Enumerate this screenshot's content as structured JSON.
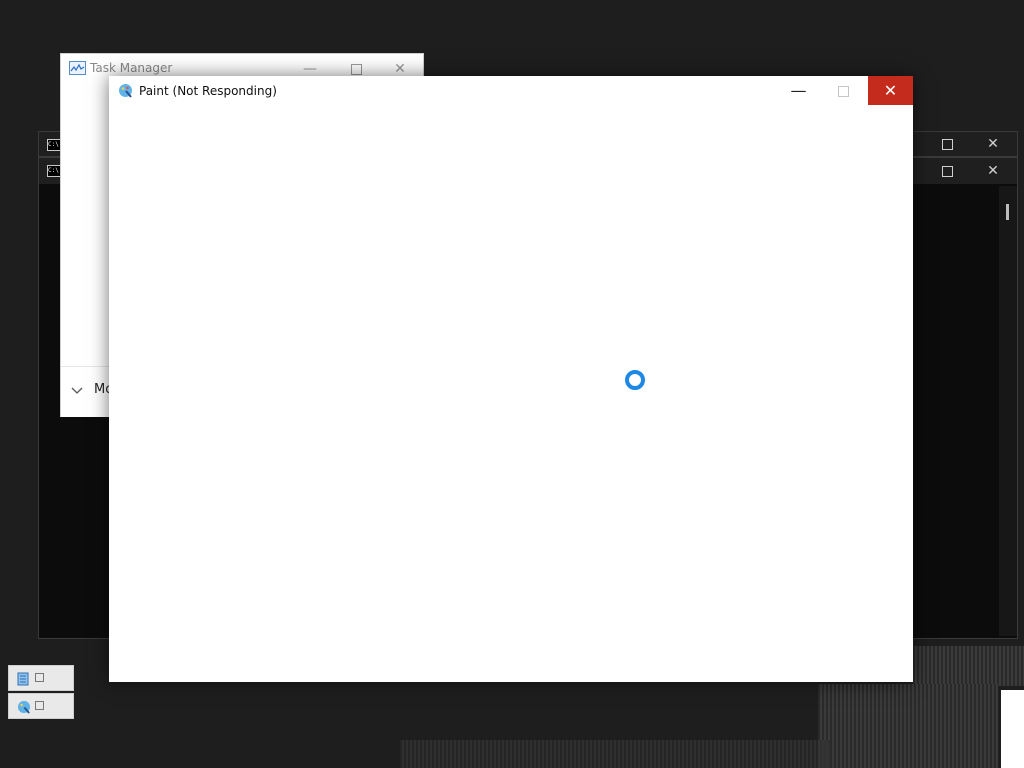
{
  "task_manager": {
    "title": "Task Manager",
    "footer_label": "Mo",
    "minimize": "—",
    "close": "✕"
  },
  "paint": {
    "title": "Paint (Not Responding)",
    "minimize": "—",
    "close": "✕",
    "state": "not-responding",
    "accent_close": "#c42b1c",
    "spinner_color": "#1e88e5"
  },
  "console_windows": [
    {
      "icon_text": "C:\\",
      "close": "✕"
    },
    {
      "icon_text": "C:\\",
      "close": "✕"
    }
  ],
  "taskbar_thumbs": [
    {
      "icon": "notepad-icon"
    },
    {
      "icon": "paint-icon"
    }
  ]
}
